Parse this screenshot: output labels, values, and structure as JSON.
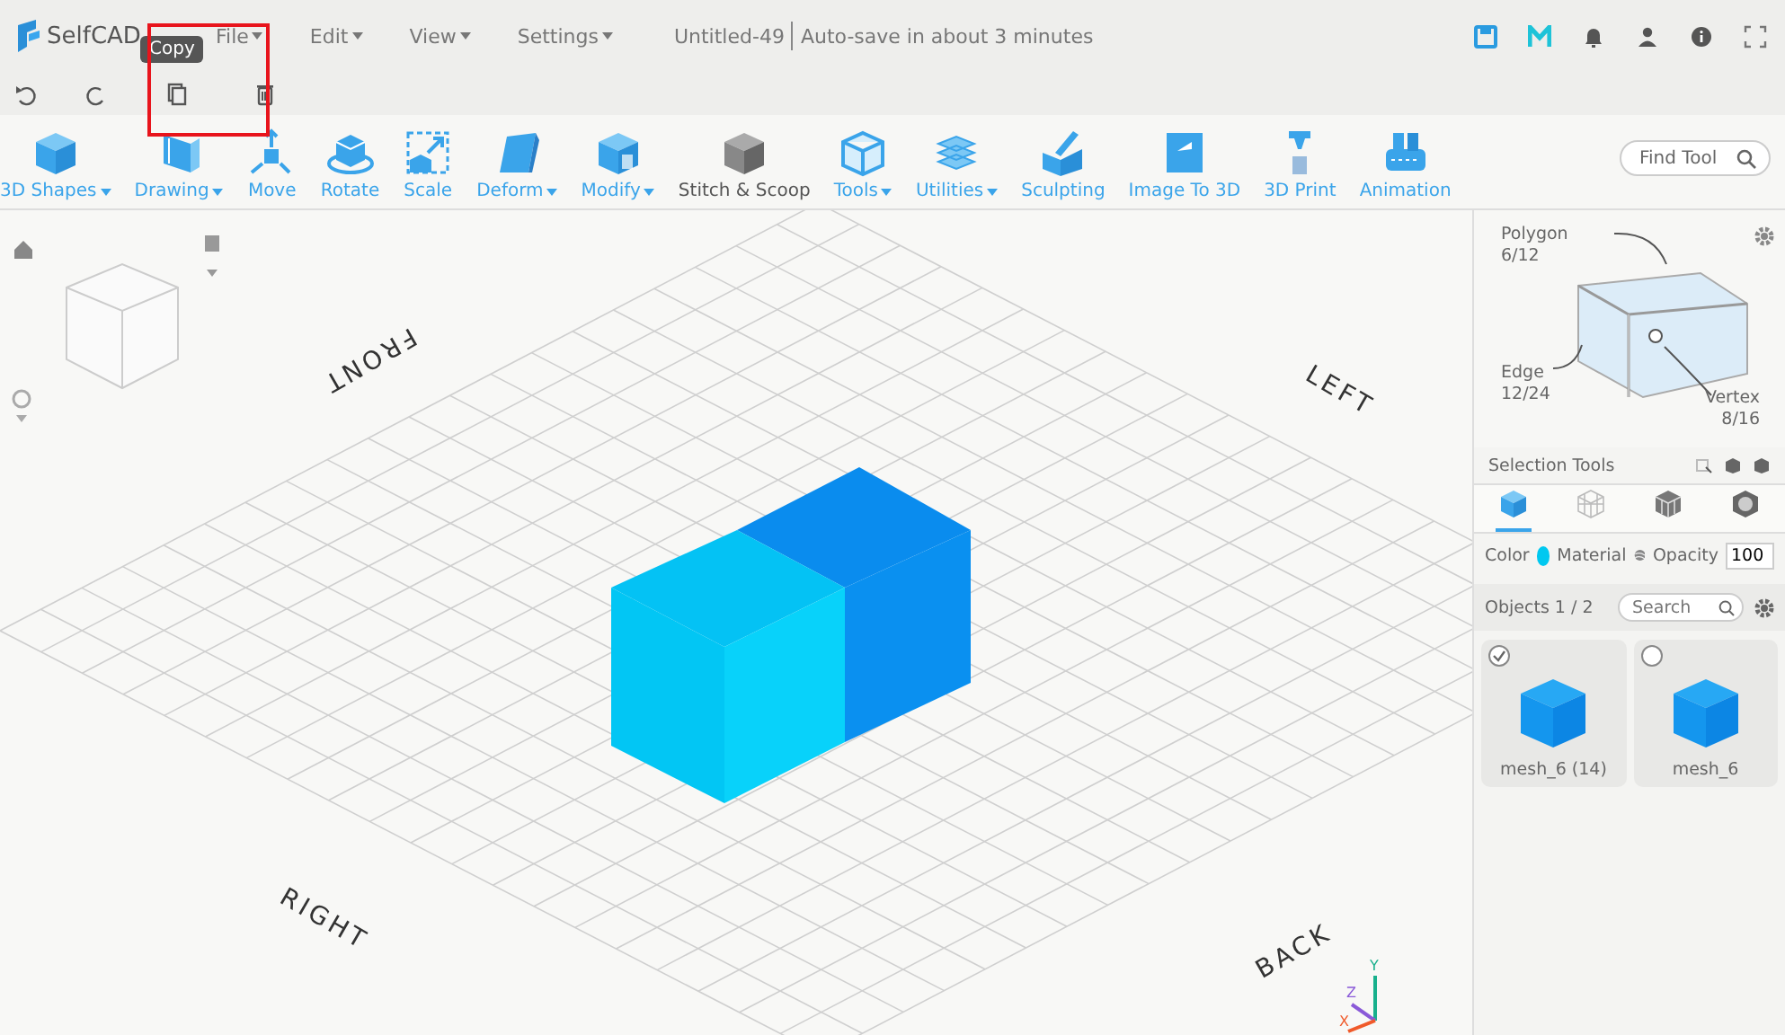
{
  "menu": {
    "logo": "SelfCAD",
    "items": [
      {
        "label": "File"
      },
      {
        "label": "Edit"
      },
      {
        "label": "View"
      },
      {
        "label": "Settings"
      }
    ]
  },
  "document": {
    "title": "Untitled-49",
    "status": "Auto-save in about 3 minutes"
  },
  "edit_bar": {
    "tooltip": "Copy"
  },
  "toolbar": {
    "tools": [
      {
        "label": "3D Shapes",
        "dropdown": true
      },
      {
        "label": "Drawing",
        "dropdown": true
      },
      {
        "label": "Move",
        "dropdown": false
      },
      {
        "label": "Rotate",
        "dropdown": false
      },
      {
        "label": "Scale",
        "dropdown": false
      },
      {
        "label": "Deform",
        "dropdown": true
      },
      {
        "label": "Modify",
        "dropdown": true
      },
      {
        "label": "Stitch & Scoop",
        "dropdown": false
      },
      {
        "label": "Tools",
        "dropdown": true
      },
      {
        "label": "Utilities",
        "dropdown": true
      },
      {
        "label": "Sculpting",
        "dropdown": false
      },
      {
        "label": "Image To 3D",
        "dropdown": false
      },
      {
        "label": "3D Print",
        "dropdown": false
      },
      {
        "label": "Animation",
        "dropdown": false
      }
    ],
    "find_placeholder": "Find Tool"
  },
  "viewport": {
    "labels": [
      "FRONT",
      "LEFT",
      "RIGHT",
      "BACK"
    ],
    "axes": [
      "X",
      "Y",
      "Z"
    ]
  },
  "panel": {
    "diagram": {
      "polygon": {
        "label": "Polygon",
        "count": "6/12"
      },
      "edge": {
        "label": "Edge",
        "count": "12/24"
      },
      "vertex": {
        "label": "Vertex",
        "count": "8/16"
      }
    },
    "selection_tools": "Selection Tools",
    "modes": [
      {
        "selected": true
      },
      {
        "selected": false
      },
      {
        "selected": false
      },
      {
        "selected": false
      }
    ],
    "color_label": "Color",
    "material_label": "Material",
    "opacity_label": "Opacity",
    "opacity_value": "100",
    "objects_title": "Objects 1 / 2",
    "search_placeholder": "Search",
    "objects": [
      {
        "name": "mesh_6 (14)",
        "checked": true
      },
      {
        "name": "mesh_6",
        "checked": false
      }
    ]
  }
}
